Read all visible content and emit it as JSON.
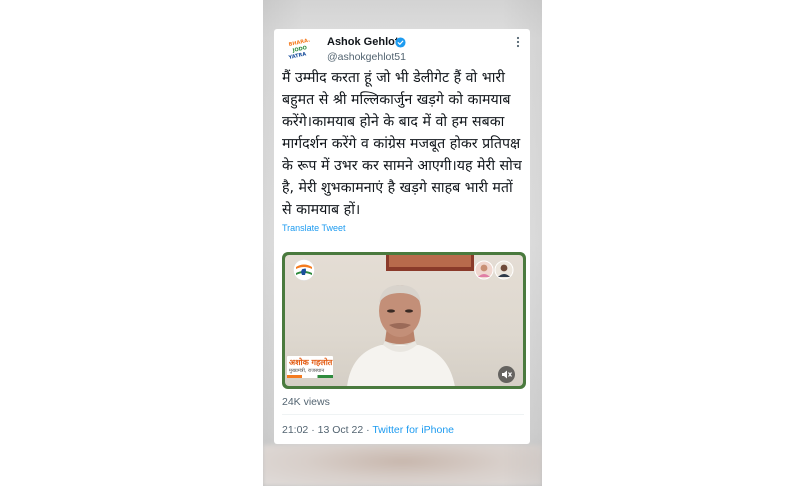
{
  "tweet": {
    "author_name": "Ashok Gehlot",
    "handle": "@ashokgehlot51",
    "avatar_text": [
      "BHARAT",
      "JODO",
      "YATRA"
    ],
    "text_lines": [
      "मैं उम्मीद करता हूं जो भी डेलीगेट हैं वो भारी",
      "बहुमत से श्री मल्लिकार्जुन खड़गे को कामयाब",
      "करेंगे।कामयाब होने के बाद में वो हम सबका",
      "मार्गदर्शन करेंगे व कांग्रेस मजबूत होकर प्रतिपक्ष",
      "के रूप में उभर कर सामने आएगी।यह मेरी सोच",
      "है, मेरी शुभकामनाएं है खड़गे साहब भारी मतों",
      "से कामयाब हों।"
    ],
    "translate_label": "Translate Tweet",
    "video": {
      "nameplate_name": "अशोक गहलोत",
      "nameplate_role": "मुख्यमंत्री, राजस्थान",
      "mute_icon": "speaker-muted-icon"
    },
    "views": "24K views",
    "time": "21:02",
    "date": "13 Oct 22",
    "separator": "·",
    "source": "Twitter for iPhone"
  },
  "colors": {
    "link": "#1d9bf0",
    "text": "#0f1419",
    "muted": "#536471",
    "saffron": "#f47b20",
    "green": "#2e8b3d"
  }
}
